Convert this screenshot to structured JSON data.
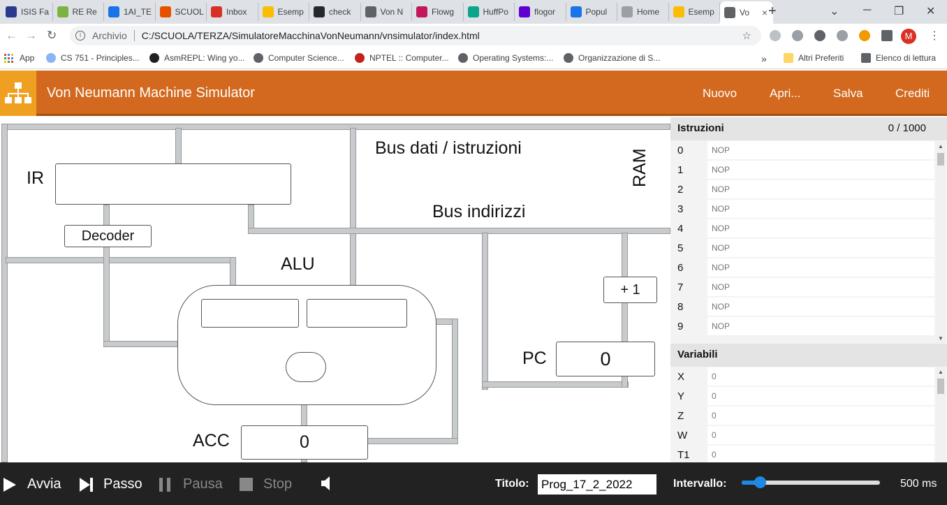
{
  "browser": {
    "tabs": [
      {
        "label": "ISIS Fa",
        "color": "#2b3a8c"
      },
      {
        "label": "RE Re",
        "color": "#7cb342"
      },
      {
        "label": "1AI_TE",
        "color": "#1a73e8"
      },
      {
        "label": "SCUOL",
        "color": "#e65100"
      },
      {
        "label": "Inbox",
        "color": "#d93025"
      },
      {
        "label": "Esemp",
        "color": "#fbbc04"
      },
      {
        "label": "check",
        "color": "#24292e"
      },
      {
        "label": "Von N",
        "color": "#5f6368"
      },
      {
        "label": "Flowg",
        "color": "#c2185b"
      },
      {
        "label": "HuffPo",
        "color": "#0aa58a"
      },
      {
        "label": "flogor",
        "color": "#6001d2"
      },
      {
        "label": "Popul",
        "color": "#1a73e8"
      },
      {
        "label": "Home",
        "color": "#9aa0a6"
      },
      {
        "label": "Esemp",
        "color": "#fbbc04"
      },
      {
        "label": "Vo",
        "color": "#5f6368"
      }
    ],
    "tab_close": "×",
    "new_tab": "+",
    "window_controls": [
      "⌄",
      "─",
      "❐",
      "✕"
    ],
    "address_label": "Archivio",
    "address_url": "C:/SCUOLA/TERZA/SimulatoreMacchinaVonNeumann/vnsimulator/index.html",
    "avatar_letter": "M",
    "bookmarks": [
      "App",
      "CS 751 - Principles...",
      "AsmREPL: Wing yo...",
      "Computer Science...",
      "NPTEL :: Computer...",
      "Operating Systems:...",
      "Organizzazione di S..."
    ],
    "bookmarks_more": "»",
    "other_bookmarks": "Altri Preferiti",
    "reading_list": "Elenco di lettura"
  },
  "app": {
    "title": "Von Neumann Machine Simulator",
    "menu": {
      "new": "Nuovo",
      "open": "Apri...",
      "save": "Salva",
      "credits": "Crediti"
    },
    "header_color": "#d2691e"
  },
  "diagram": {
    "ir_label": "IR",
    "ir_value": "",
    "decoder": "Decoder",
    "alu_label": "ALU",
    "alu_in1": "",
    "alu_in2": "",
    "alu_op": "",
    "acc_label": "ACC",
    "acc_value": "0",
    "data_bus": "Bus dati / istruzioni",
    "addr_bus": "Bus indirizzi",
    "ram_label": "RAM",
    "increment": "+ 1",
    "pc_label": "PC",
    "pc_value": "0"
  },
  "panel": {
    "instructions_title": "Istruzioni",
    "instructions_count": "0 / 1000",
    "instructions": [
      {
        "n": "0",
        "op": "NOP"
      },
      {
        "n": "1",
        "op": "NOP"
      },
      {
        "n": "2",
        "op": "NOP"
      },
      {
        "n": "3",
        "op": "NOP"
      },
      {
        "n": "4",
        "op": "NOP"
      },
      {
        "n": "5",
        "op": "NOP"
      },
      {
        "n": "6",
        "op": "NOP"
      },
      {
        "n": "7",
        "op": "NOP"
      },
      {
        "n": "8",
        "op": "NOP"
      },
      {
        "n": "9",
        "op": "NOP"
      }
    ],
    "variables_title": "Variabili",
    "variables": [
      {
        "n": "X",
        "v": "0"
      },
      {
        "n": "Y",
        "v": "0"
      },
      {
        "n": "Z",
        "v": "0"
      },
      {
        "n": "W",
        "v": "0"
      },
      {
        "n": "T1",
        "v": "0"
      }
    ]
  },
  "controls": {
    "run": "Avvia",
    "step": "Passo",
    "pause": "Pausa",
    "stop": "Stop",
    "title_label": "Titolo:",
    "title_value": "Prog_17_2_2022",
    "interval_label": "Intervallo:",
    "interval_value": "500 ms",
    "interval_slider_fraction": 0.1
  }
}
